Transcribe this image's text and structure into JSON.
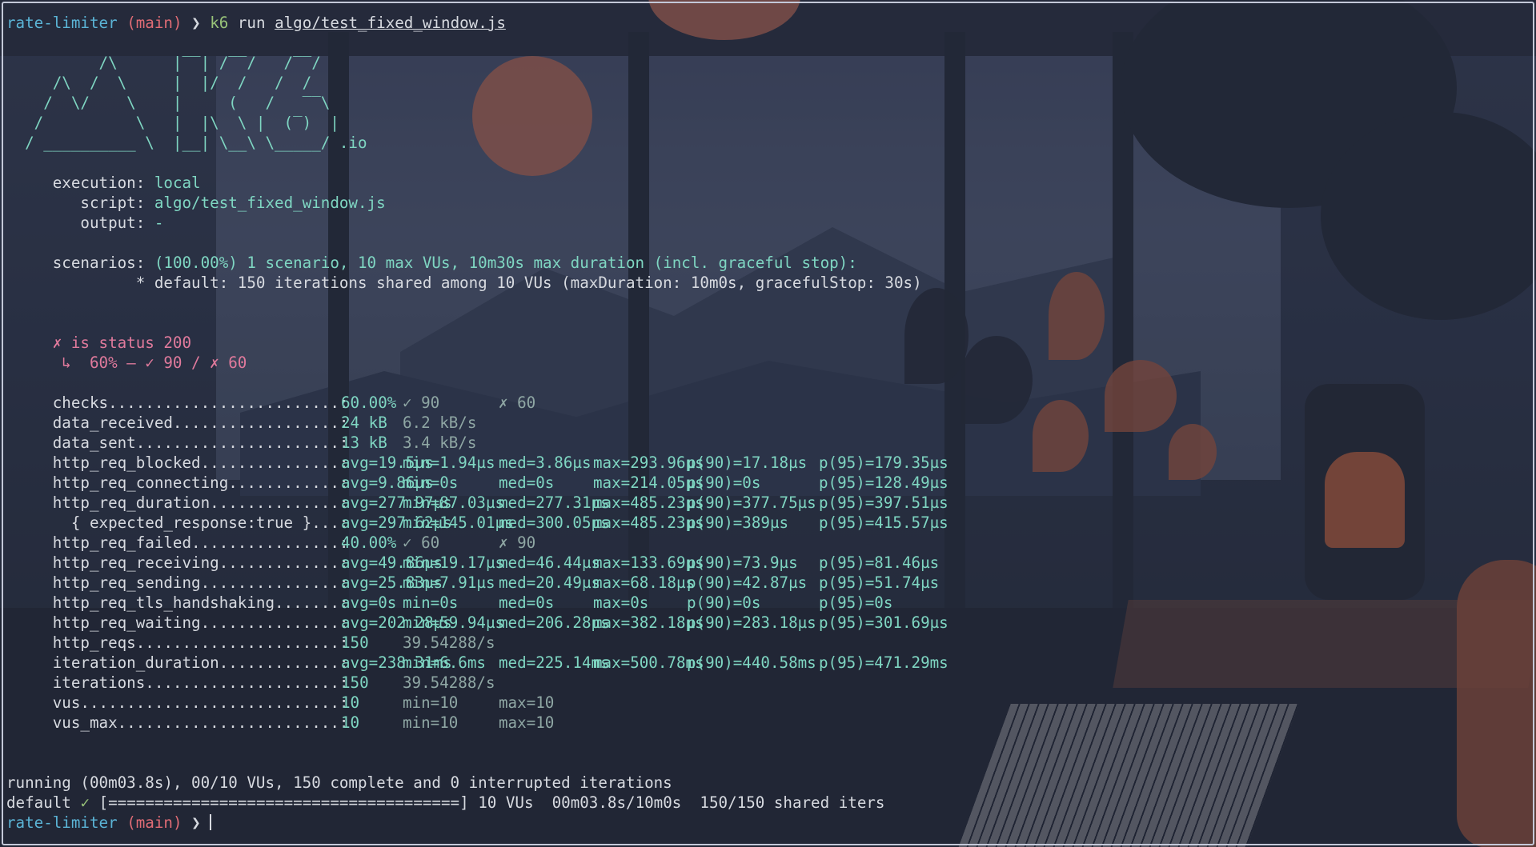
{
  "prompt": {
    "dir": "rate-limiter",
    "branch": "(main)",
    "arrow": "❯",
    "command": "k6",
    "arg_prefix": "run",
    "arg_file": "algo/test_fixed_window.js"
  },
  "logo": [
    "          /\\      |‾‾| /‾‾/   /‾‾/",
    "     /\\  /  \\     |  |/  /   /  /",
    "    /  \\/    \\    |     (   /   ‾‾\\",
    "   /          \\   |  |\\  \\ |  (‾)  |",
    "  / __________ \\  |__| \\__\\ \\_____/ .io"
  ],
  "execution": [
    {
      "key": "     execution:",
      "value": "local"
    },
    {
      "key": "        script:",
      "value": "algo/test_fixed_window.js"
    },
    {
      "key": "        output:",
      "value": "-"
    }
  ],
  "scenarios": {
    "key": "     scenarios:",
    "value": "(100.00%) 1 scenario, 10 max VUs, 10m30s max duration (incl. graceful stop):",
    "detail": "              * default: 150 iterations shared among 10 VUs (maxDuration: 10m0s, gracefulStop: 30s)"
  },
  "check_result": {
    "title": "     ✗ is status 200",
    "detail": "      ↳  60% — ✓ 90 / ✗ 60"
  },
  "metrics": [
    {
      "name": "     checks.........................:",
      "c1": "60.00%",
      "c2": "✓ 90",
      "c3": "✗ 60",
      "c4": "",
      "c5": "",
      "c6": ""
    },
    {
      "name": "     data_received..................:",
      "c1": "24 kB",
      "c2": "6.2 kB/s",
      "c3": "",
      "c4": "",
      "c5": "",
      "c6": ""
    },
    {
      "name": "     data_sent......................:",
      "c1": "13 kB",
      "c2": "3.4 kB/s",
      "c3": "",
      "c4": "",
      "c5": "",
      "c6": ""
    },
    {
      "name": "     http_req_blocked...............:",
      "c1": "avg=19.5µs",
      "c2": "min=1.94µs",
      "c3": "med=3.86µs",
      "c4": "max=293.96µs",
      "c5": "p(90)=17.18µs",
      "c6": "p(95)=179.35µs"
    },
    {
      "name": "     http_req_connecting............:",
      "c1": "avg=9.86µs",
      "c2": "min=0s",
      "c3": "med=0s",
      "c4": "max=214.05µs",
      "c5": "p(90)=0s",
      "c6": "p(95)=128.49µs"
    },
    {
      "name": "     http_req_duration..............:",
      "c1": "avg=277.97µs",
      "c2": "min=87.03µs",
      "c3": "med=277.31µs",
      "c4": "max=485.23µs",
      "c5": "p(90)=377.75µs",
      "c6": "p(95)=397.51µs"
    },
    {
      "name": "       { expected_response:true }...:",
      "c1": "avg=297.62µs",
      "c2": "min=145.01µs",
      "c3": "med=300.05µs",
      "c4": "max=485.23µs",
      "c5": "p(90)=389µs",
      "c6": "p(95)=415.57µs"
    },
    {
      "name": "     http_req_failed................:",
      "c1": "40.00%",
      "c2": "✓ 60",
      "c3": "✗ 90",
      "c4": "",
      "c5": "",
      "c6": ""
    },
    {
      "name": "     http_req_receiving.............:",
      "c1": "avg=49.86µs",
      "c2": "min=19.17µs",
      "c3": "med=46.44µs",
      "c4": "max=133.69µs",
      "c5": "p(90)=73.9µs",
      "c6": "p(95)=81.46µs"
    },
    {
      "name": "     http_req_sending...............:",
      "c1": "avg=25.83µs",
      "c2": "min=7.91µs",
      "c3": "med=20.49µs",
      "c4": "max=68.18µs",
      "c5": "p(90)=42.87µs",
      "c6": "p(95)=51.74µs"
    },
    {
      "name": "     http_req_tls_handshaking.......:",
      "c1": "avg=0s",
      "c2": "min=0s",
      "c3": "med=0s",
      "c4": "max=0s",
      "c5": "p(90)=0s",
      "c6": "p(95)=0s"
    },
    {
      "name": "     http_req_waiting...............:",
      "c1": "avg=202.28µs",
      "c2": "min=59.94µs",
      "c3": "med=206.28µs",
      "c4": "max=382.18µs",
      "c5": "p(90)=283.18µs",
      "c6": "p(95)=301.69µs"
    },
    {
      "name": "     http_reqs......................:",
      "c1": "150",
      "c2": "39.54288/s",
      "c3": "",
      "c4": "",
      "c5": "",
      "c6": ""
    },
    {
      "name": "     iteration_duration.............:",
      "c1": "avg=238.31ms",
      "c2": "min=6.6ms",
      "c3": "med=225.14ms",
      "c4": "max=500.78ms",
      "c5": "p(90)=440.58ms",
      "c6": "p(95)=471.29ms"
    },
    {
      "name": "     iterations.....................:",
      "c1": "150",
      "c2": "39.54288/s",
      "c3": "",
      "c4": "",
      "c5": "",
      "c6": ""
    },
    {
      "name": "     vus............................:",
      "c1": "10",
      "c2": "min=10",
      "c3": "max=10",
      "c4": "",
      "c5": "",
      "c6": ""
    },
    {
      "name": "     vus_max........................:",
      "c1": "10",
      "c2": "min=10",
      "c3": "max=10",
      "c4": "",
      "c5": "",
      "c6": ""
    }
  ],
  "summary": {
    "running": "running (00m03.8s), 00/10 VUs, 150 complete and 0 interrupted iterations",
    "default_label": "default",
    "default_check": "✓",
    "progress": "[======================================] 10 VUs  00m03.8s/10m0s  150/150 shared iters",
    "progress_fraction": 1.0
  },
  "colors": {
    "prompt_dir": "#5bb4d6",
    "prompt_branch": "#e06c75",
    "command": "#98c379",
    "value": "#7fd6c2",
    "failure": "#e07a9c"
  }
}
